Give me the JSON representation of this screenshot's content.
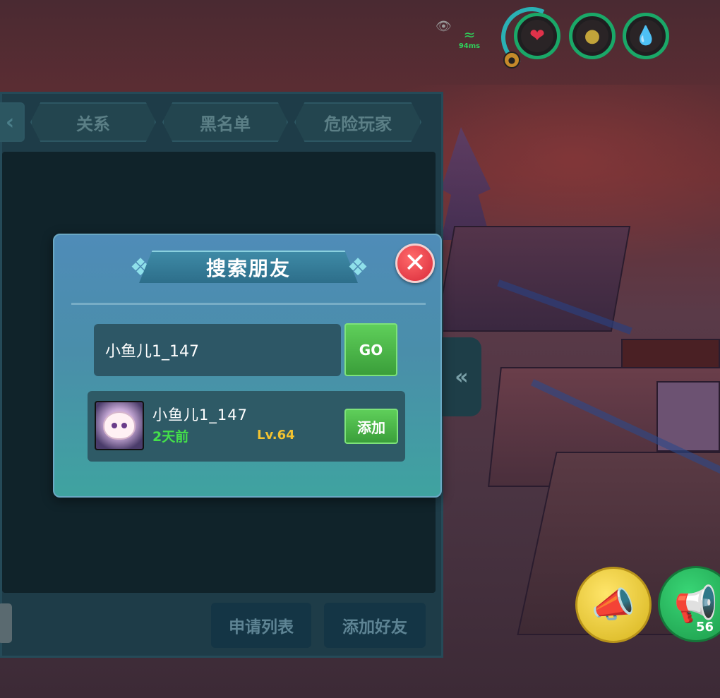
{
  "hud": {
    "ping": "94ms",
    "voice_count": "56"
  },
  "friends_panel": {
    "tabs": [
      {
        "label": "关系"
      },
      {
        "label": "黑名单"
      },
      {
        "label": "危险玩家"
      }
    ],
    "apply_list_label": "申请列表",
    "add_friend_label": "添加好友"
  },
  "search_dialog": {
    "title": "搜索朋友",
    "input_value": "小鱼儿1_147",
    "go_label": "GO",
    "result": {
      "name": "小鱼儿1_147",
      "last_online": "2天前",
      "level": "Lv.64",
      "add_label": "添加"
    }
  },
  "colors": {
    "accent_green": "#3a9e3a",
    "online_green": "#44e04a",
    "level_gold": "#f2c230",
    "close_red": "#d92a3a"
  }
}
